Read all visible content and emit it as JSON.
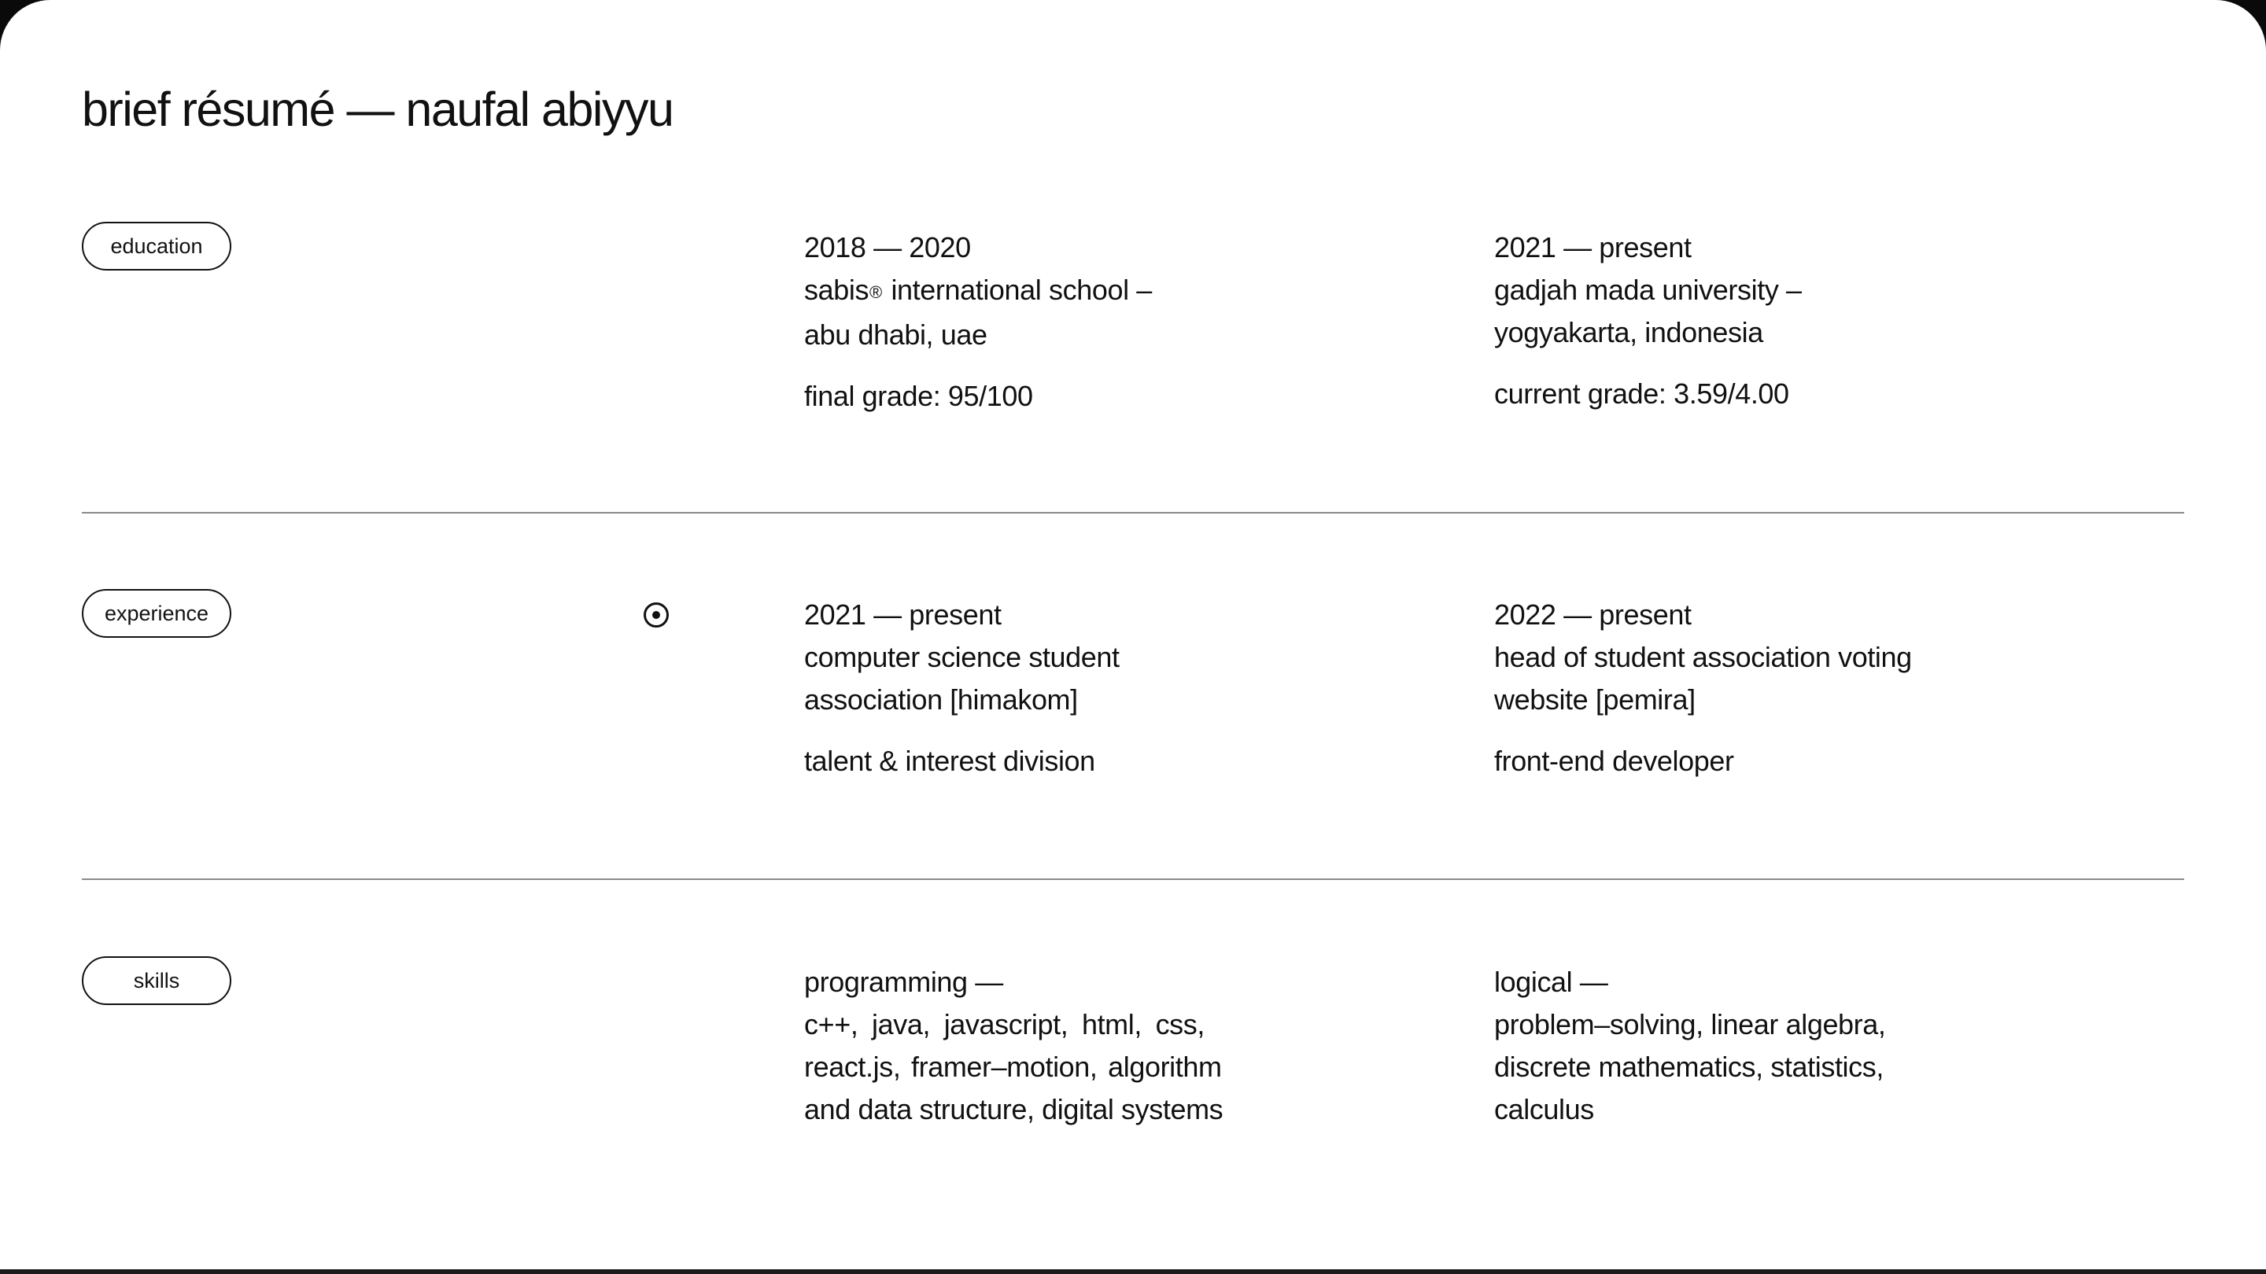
{
  "title": "brief résumé — naufal abiyyu",
  "education": {
    "label": "education",
    "entries": [
      {
        "period": "2018 — 2020",
        "school_part1": "sabis",
        "registered_mark": "®",
        "school_part2": " international school –",
        "location": "abu dhabi, uae",
        "grade": "final grade: 95/100"
      },
      {
        "period": "2021 — present",
        "school_line1": "gadjah mada university –",
        "location": "yogyakarta, indonesia",
        "grade": "current grade: 3.59/4.00"
      }
    ]
  },
  "experience": {
    "label": "experience",
    "entries": [
      {
        "period": "2021 — present",
        "line1": "computer science student",
        "line2": "association [himakom]",
        "role": "talent & interest division"
      },
      {
        "period": "2022 — present",
        "line1": "head of student association voting",
        "line2": "website [pemira]",
        "role": "front-end developer"
      }
    ]
  },
  "skills": {
    "label": "skills",
    "groups": [
      {
        "heading": "programming —",
        "lines": [
          "c++, java, javascript, html, css,",
          "react.js, framer–motion, algorithm",
          "and data structure, digital systems"
        ]
      },
      {
        "heading": "logical —",
        "lines": [
          "problem–solving, linear algebra,",
          "discrete mathematics, statistics,",
          "calculus"
        ]
      }
    ]
  },
  "icons": {
    "cursor": "target-cursor-icon"
  }
}
